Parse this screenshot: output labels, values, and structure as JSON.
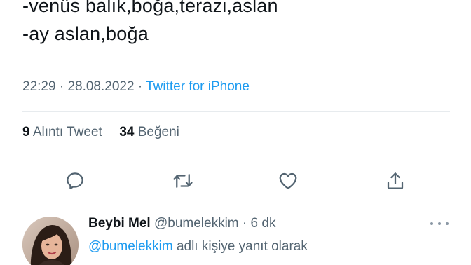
{
  "tweet": {
    "lines": [
      "-venüs balık,boğa,terazi,aslan",
      "-ay aslan,boğa"
    ],
    "time": "22:29",
    "date": "28.08.2022",
    "separator": "·",
    "source": "Twitter for iPhone"
  },
  "stats": {
    "quote_count": "9",
    "quote_label": "Alıntı Tweet",
    "like_count": "34",
    "like_label": "Beğeni"
  },
  "actions": [
    {
      "icon": "reply-icon"
    },
    {
      "icon": "retweet-icon"
    },
    {
      "icon": "like-icon"
    },
    {
      "icon": "share-icon"
    }
  ],
  "reply": {
    "display_name": "Beybi Mel",
    "handle": "@bumelekkim",
    "separator": "·",
    "time_ago": "6 dk",
    "reply_to_mention": "@bumelekkim",
    "reply_to_suffix": "adlı kişiye yanıt olarak"
  },
  "colors": {
    "text": "#0f1419",
    "secondary": "#536471",
    "accent": "#1d9bf0",
    "divider": "#e7ebee"
  }
}
